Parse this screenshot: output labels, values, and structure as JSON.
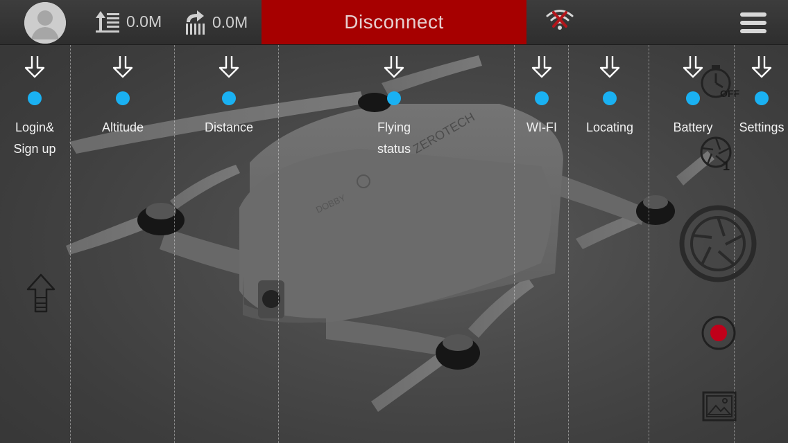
{
  "header": {
    "altitude_value": "0.0M",
    "distance_value": "0.0M",
    "connection_button": "Disconnect",
    "icons": {
      "avatar": "user-avatar-icon",
      "altitude": "altitude-icon",
      "distance": "distance-icon",
      "wifi": "wifi-disconnected-icon",
      "menu": "hamburger-menu-icon"
    }
  },
  "guides": [
    {
      "label": "Login&\nSign up"
    },
    {
      "label": "Altitude"
    },
    {
      "label": "Distance"
    },
    {
      "label": "Flying status"
    },
    {
      "label": "WI-FI"
    },
    {
      "label": "Locating"
    },
    {
      "label": "Battery"
    },
    {
      "label": "Settings"
    }
  ],
  "drone": {
    "brand_text": "ZEROTECH",
    "model_text": "DOBBY"
  },
  "right_controls": {
    "timer_badge": "OFF",
    "burst_count": "1",
    "icons": [
      "timer-off-icon",
      "photo-mode-icon",
      "shutter-icon",
      "record-icon",
      "gallery-icon"
    ]
  },
  "left_controls": {
    "icons": [
      "takeoff-arrow-icon"
    ]
  },
  "colors": {
    "disconnect_bg": "#a60000",
    "guide_dot": "#1ab1f2",
    "record_dot": "#c0001a",
    "wifi_cross": "#b3161b"
  }
}
